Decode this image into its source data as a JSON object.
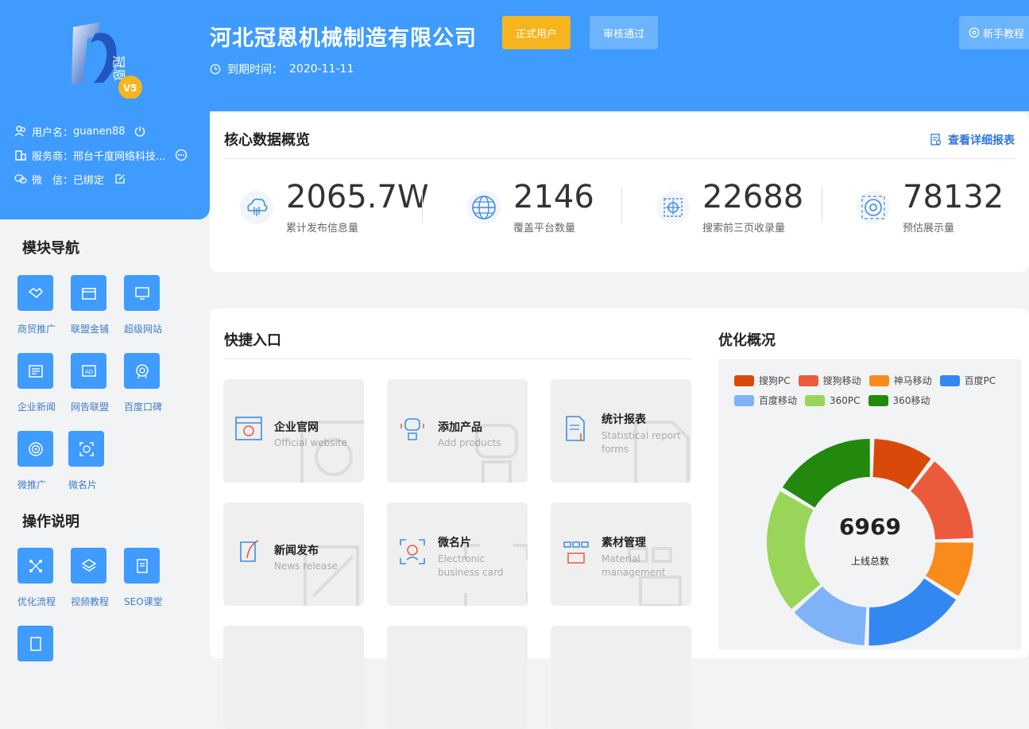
{
  "header": {
    "company": "河北冠恩机械制造有限公司",
    "badge_formal": "正式用户",
    "badge_audit": "审核通过",
    "tutorial": "新手教程",
    "expire_label": "到期时间：",
    "expire_date": "2020-11-11"
  },
  "logo": {
    "text": "冠恩",
    "version": "V5"
  },
  "user": {
    "username_label": "用户名：",
    "username": "guanen88",
    "provider_label": "服务商：",
    "provider": "邢台千度网络科技...",
    "wechat_label": "微　信：",
    "wechat": "已绑定"
  },
  "core": {
    "title": "核心数据概览",
    "report_link": "查看详细报表",
    "stats": [
      {
        "value": "2065.7W",
        "label": "累计发布信息量"
      },
      {
        "value": "2146",
        "label": "覆盖平台数量"
      },
      {
        "value": "22688",
        "label": "搜索前三页收录量"
      },
      {
        "value": "78132",
        "label": "预估展示量"
      }
    ]
  },
  "nav": {
    "module_title": "模块导航",
    "modules": [
      "商贸推广",
      "联盟金铺",
      "超级网站",
      "企业新闻",
      "网告联盟",
      "百度口碑",
      "微推广",
      "微名片"
    ],
    "ops_title": "操作说明",
    "ops": [
      "优化流程",
      "视频教程",
      "SEO课堂"
    ]
  },
  "quick": {
    "title": "快捷入口",
    "items": [
      {
        "title": "企业官网",
        "sub": "Official website"
      },
      {
        "title": "添加产品",
        "sub": "Add products"
      },
      {
        "title": "统计报表",
        "sub": "Statistical report forms"
      },
      {
        "title": "新闻发布",
        "sub": "News release"
      },
      {
        "title": "微名片",
        "sub": "Electronic business card"
      },
      {
        "title": "素材管理",
        "sub": "Material management"
      }
    ]
  },
  "optimization": {
    "title": "优化概况",
    "total": "6969",
    "total_label": "上线总数"
  },
  "chart_data": {
    "type": "pie",
    "categories": [
      "搜狗PC",
      "搜狗移动",
      "神马移动",
      "百度PC",
      "百度移动",
      "360PC",
      "360移动"
    ],
    "colors": [
      "#d94a0a",
      "#ec5a3c",
      "#f98a1c",
      "#3288f0",
      "#7fb2f7",
      "#99d558",
      "#22890e"
    ],
    "values": [
      700,
      1000,
      650,
      1150,
      900,
      1400,
      1169
    ]
  }
}
